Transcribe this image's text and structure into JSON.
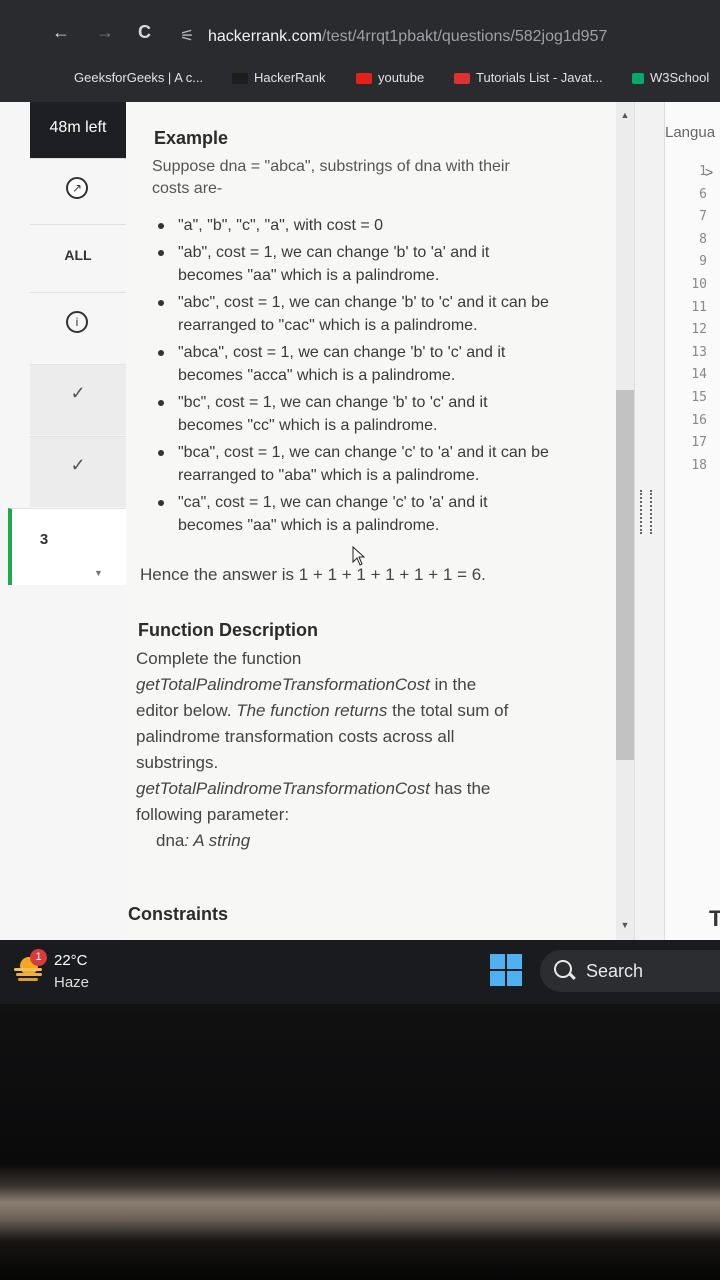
{
  "browser": {
    "back": "←",
    "forward": "→",
    "reload": "C",
    "tune_icon": "⚟",
    "url_host": "hackerrank.com",
    "url_path": "/test/4rrqt1pbakt/questions/582jog1d957"
  },
  "bookmarks": [
    {
      "label": "GeeksforGeeks | A c...",
      "color": "#2f8d46"
    },
    {
      "label": "HackerRank",
      "color": "#1ba94c"
    },
    {
      "label": "youtube",
      "color": "#ff0000"
    },
    {
      "label": "Tutorials List - Javat...",
      "color": "#e03131"
    },
    {
      "label": "W3School",
      "color": "#04aa6d"
    }
  ],
  "sidebar": {
    "timer": "48m left",
    "all_label": "ALL",
    "info_icon": "i",
    "check_mark": "✓",
    "current_question": "3"
  },
  "problem": {
    "example_heading": "Example",
    "example_intro_1": "Suppose dna = \"abca\", substrings of dna with their",
    "example_intro_2": "costs are-",
    "bullets": [
      {
        "l1": "\"a\", \"b\", \"c\", \"a\", with cost = 0",
        "l2": ""
      },
      {
        "l1": "\"ab\", cost = 1, we can change 'b' to 'a' and it",
        "l2": "becomes \"aa\" which is a palindrome."
      },
      {
        "l1": "\"abc\", cost = 1, we can change 'b' to 'c' and it can be",
        "l2": "rearranged to \"cac\" which is a palindrome."
      },
      {
        "l1": "\"abca\", cost = 1, we can change 'b' to 'c' and it",
        "l2": "becomes \"acca\" which is a palindrome."
      },
      {
        "l1": "\"bc\", cost = 1, we can change 'b' to 'c' and it",
        "l2": "becomes \"cc\" which is a palindrome."
      },
      {
        "l1": "\"bca\", cost = 1, we can change 'c' to 'a' and it can be",
        "l2": "rearranged to \"aba\" which is a palindrome."
      },
      {
        "l1": "\"ca\", cost = 1, we can change 'c' to 'a' and it",
        "l2": "becomes \"aa\" which is a palindrome."
      }
    ],
    "answer_line": "Hence the answer is 1 + 1 + 1 + 1 + 1 + 1 = 6.",
    "function_heading": "Function Description",
    "fd_line1": "Complete the function",
    "fd_func_name": "getTotalPalindromeTransformationCost",
    "fd_line2_rest": " in the",
    "fd_line3_a": "editor below. ",
    "fd_line3_b": "The function returns",
    "fd_line3_c": " the total sum of",
    "fd_line4": "palindrome transformation costs across all",
    "fd_line5": "substrings.",
    "fd_param_func": "getTotalPalindromeTransformationCost",
    "fd_param_rest": " has the",
    "fd_param_line2": "following parameter:",
    "param_name": "dna",
    "param_desc": ": A string",
    "constraints_heading": "Constraints"
  },
  "editor": {
    "language_label": "Langua",
    "line_numbers": [
      "1",
      "6",
      "7",
      "8",
      "9",
      "10",
      "11",
      "12",
      "13",
      "14",
      "15",
      "16",
      "17",
      "18"
    ],
    "chevron": ">",
    "bottom_letter": "T"
  },
  "taskbar": {
    "notification_count": "1",
    "temperature": "22°C",
    "weather": "Haze",
    "search_label": "Search"
  }
}
